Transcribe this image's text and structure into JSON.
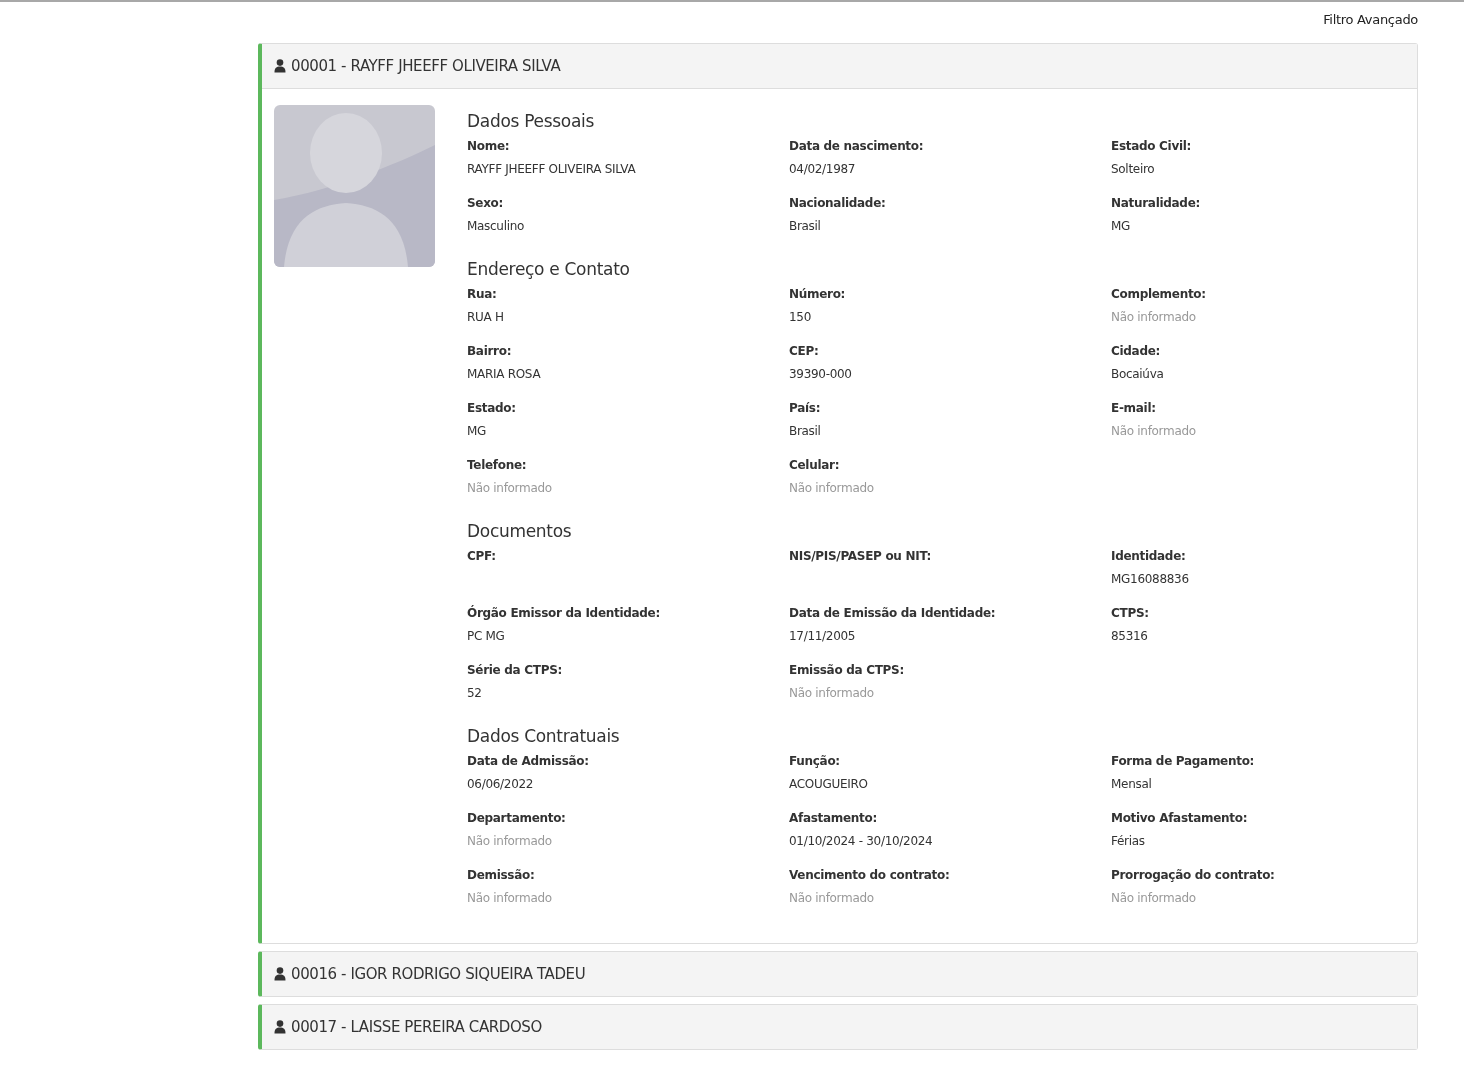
{
  "filter_link": "Filtro Avançado",
  "employees": [
    {
      "title": "00001 - RAYFF JHEEFF OLIVEIRA SILVA",
      "expanded": true,
      "sections": [
        {
          "title": "Dados Pessoais",
          "fields": [
            {
              "label": "Nome:",
              "value": "RAYFF JHEEFF OLIVEIRA SILVA",
              "empty": false
            },
            {
              "label": "Data de nascimento:",
              "value": "04/02/1987",
              "empty": false
            },
            {
              "label": "Estado Civil:",
              "value": "Solteiro",
              "empty": false
            },
            {
              "label": "Sexo:",
              "value": "Masculino",
              "empty": false
            },
            {
              "label": "Nacionalidade:",
              "value": "Brasil",
              "empty": false
            },
            {
              "label": "Naturalidade:",
              "value": "MG",
              "empty": false
            }
          ]
        },
        {
          "title": "Endereço e Contato",
          "fields": [
            {
              "label": "Rua:",
              "value": "RUA H",
              "empty": false
            },
            {
              "label": "Número:",
              "value": "150",
              "empty": false
            },
            {
              "label": "Complemento:",
              "value": "Não informado",
              "empty": true
            },
            {
              "label": "Bairro:",
              "value": "MARIA ROSA",
              "empty": false
            },
            {
              "label": "CEP:",
              "value": "39390-000",
              "empty": false
            },
            {
              "label": "Cidade:",
              "value": "Bocaiúva",
              "empty": false
            },
            {
              "label": "Estado:",
              "value": "MG",
              "empty": false
            },
            {
              "label": "País:",
              "value": "Brasil",
              "empty": false
            },
            {
              "label": "E-mail:",
              "value": "Não informado",
              "empty": true
            },
            {
              "label": "Telefone:",
              "value": "Não informado",
              "empty": true
            },
            {
              "label": "Celular:",
              "value": "Não informado",
              "empty": true
            }
          ]
        },
        {
          "title": "Documentos",
          "fields": [
            {
              "label": "CPF:"
            },
            {
              "label": "NIS/PIS/PASEP ou NIT:"
            },
            {
              "label": "Identidade:",
              "value": "MG16088836",
              "empty": false
            },
            {
              "label": "Órgão Emissor da Identidade:",
              "value": "PC MG",
              "empty": false
            },
            {
              "label": "Data de Emissão da Identidade:",
              "value": "17/11/2005",
              "empty": false
            },
            {
              "label": "CTPS:",
              "value": "85316",
              "empty": false
            },
            {
              "label": "Série da CTPS:",
              "value": "52",
              "empty": false
            },
            {
              "label": "Emissão da CTPS:",
              "value": "Não informado",
              "empty": true
            }
          ]
        },
        {
          "title": "Dados Contratuais",
          "fields": [
            {
              "label": "Data de Admissão:",
              "value": "06/06/2022",
              "empty": false
            },
            {
              "label": "Função:",
              "value": "ACOUGUEIRO",
              "empty": false
            },
            {
              "label": "Forma de Pagamento:",
              "value": "Mensal",
              "empty": false
            },
            {
              "label": "Departamento:",
              "value": "Não informado",
              "empty": true
            },
            {
              "label": "Afastamento:",
              "value": "01/10/2024 - 30/10/2024",
              "empty": false
            },
            {
              "label": "Motivo Afastamento:",
              "value": "Férias",
              "empty": false
            },
            {
              "label": "Demissão:",
              "value": "Não informado",
              "empty": true
            },
            {
              "label": "Vencimento do contrato:",
              "value": "Não informado",
              "empty": true
            },
            {
              "label": "Prorrogação do contrato:",
              "value": "Não informado",
              "empty": true
            }
          ]
        }
      ]
    },
    {
      "title": "00016 - IGOR RODRIGO SIQUEIRA TADEU",
      "expanded": false
    },
    {
      "title": "00017 - LAISSE PEREIRA CARDOSO",
      "expanded": false
    }
  ]
}
